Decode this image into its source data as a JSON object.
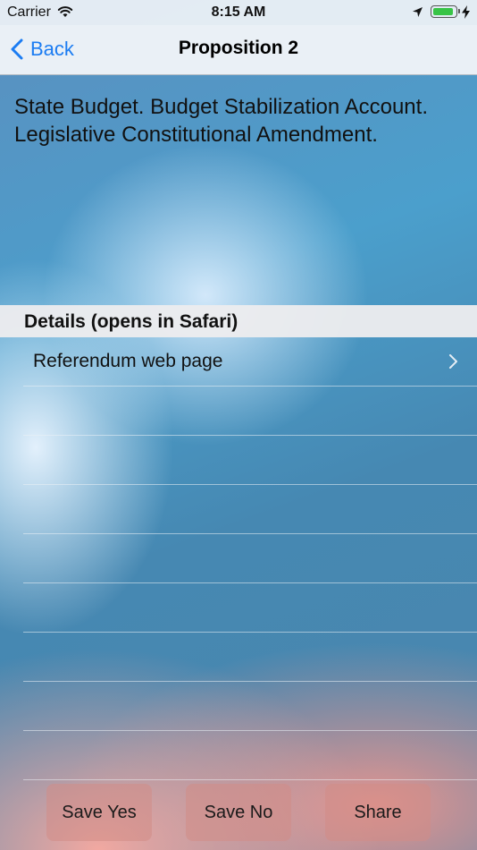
{
  "status_bar": {
    "carrier": "Carrier",
    "time": "8:15 AM",
    "icons": [
      "wifi-icon",
      "location-arrow-icon",
      "battery-icon",
      "charging-bolt-icon"
    ],
    "battery_color": "#37c446"
  },
  "nav": {
    "back_label": "Back",
    "title": "Proposition 2",
    "accent_color": "#1b7cf2"
  },
  "description": "State Budget. Budget Stabilization Account. Legislative Constitutional Amendment.",
  "details_section": {
    "header": "Details (opens in Safari)",
    "rows": [
      {
        "label": "Referendum web page",
        "icon": "chevron-right-icon"
      }
    ]
  },
  "toolbar": {
    "save_yes": "Save Yes",
    "save_no": "Save No",
    "share": "Share"
  }
}
